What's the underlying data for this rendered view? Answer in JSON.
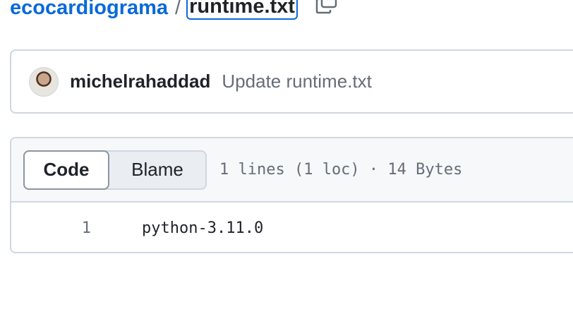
{
  "breadcrumb": {
    "repo": "ecocardiograma",
    "separator": "/",
    "file": "runtime.txt"
  },
  "copy_icon": "copy-icon",
  "commit": {
    "avatar_icon": "user-avatar",
    "author": "michelrahaddad",
    "message": "Update runtime.txt"
  },
  "file": {
    "tabs": [
      {
        "label": "Code",
        "selected": true
      },
      {
        "label": "Blame",
        "selected": false
      }
    ],
    "info": "1 lines (1 loc) · 14 Bytes",
    "lines": [
      {
        "number": "1",
        "code": "python-3.11.0"
      }
    ]
  },
  "colors": {
    "link": "#0969da",
    "border": "#d0d7de",
    "muted": "#656d76",
    "header_bg": "#f6f8fa"
  }
}
